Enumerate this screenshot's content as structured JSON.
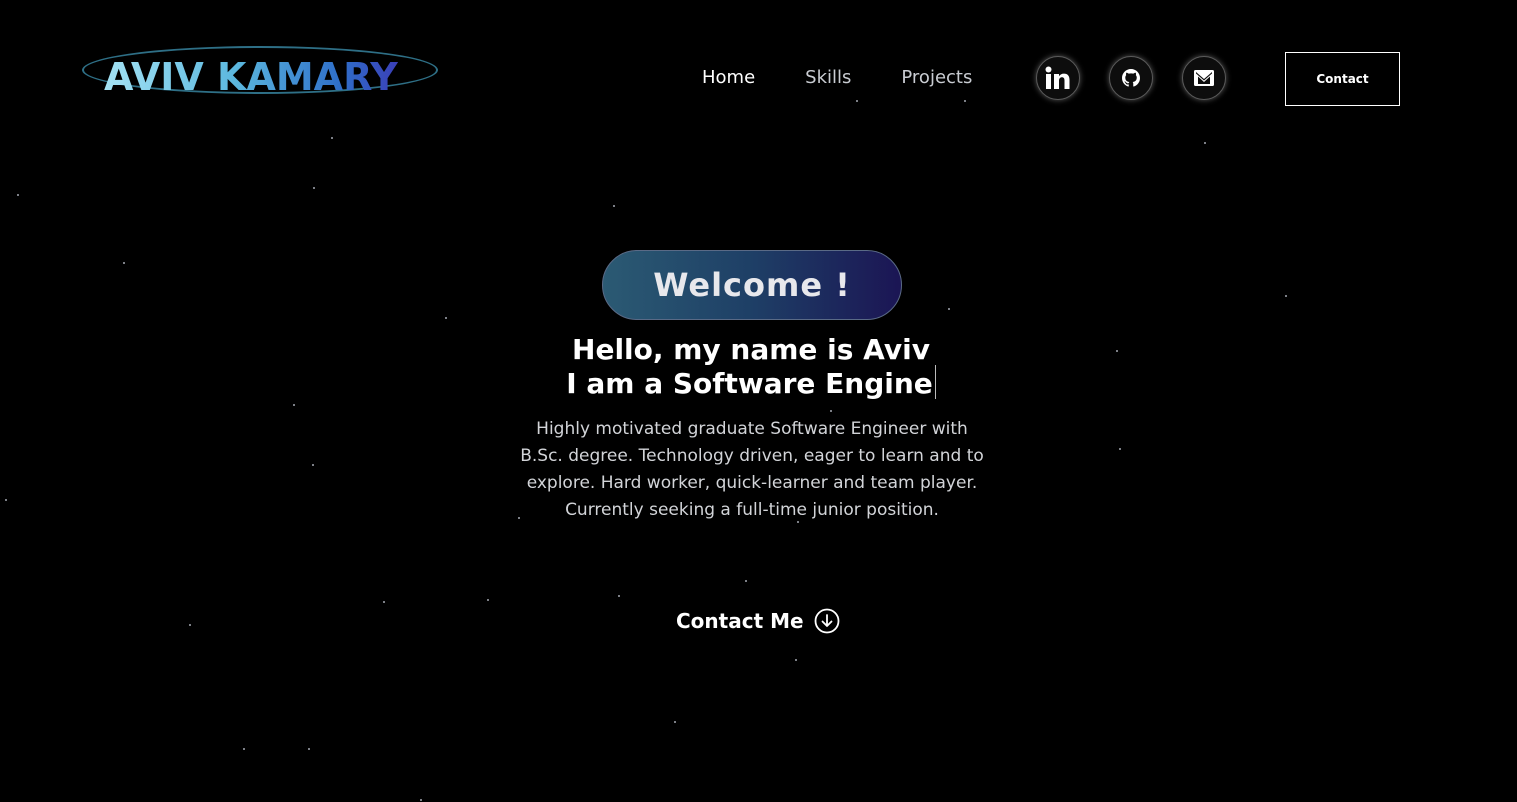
{
  "logo": {
    "text": "AVIV KAMARY"
  },
  "nav": {
    "links": [
      {
        "label": "Home"
      },
      {
        "label": "Skills"
      },
      {
        "label": "Projects"
      }
    ],
    "social": [
      {
        "icon": "linkedin-icon"
      },
      {
        "icon": "github-icon"
      },
      {
        "icon": "mail-icon"
      }
    ],
    "contact_label": "Contact"
  },
  "hero": {
    "badge": "Welcome !",
    "title_line1": "Hello, my name is Aviv",
    "title_line2": "I am a Software Engine",
    "description": "Highly motivated graduate Software Engineer with B.Sc. degree. Technology driven, eager to learn and to explore. Hard worker, quick-learner and team player.",
    "description2": "Currently seeking a full-time junior position.",
    "cta_label": "Contact Me"
  },
  "colors": {
    "background": "#000000",
    "logo_gradient_start": "#a4e2f4",
    "logo_gradient_end": "#3a3fb8",
    "badge_gradient_start": "#2b5a73",
    "badge_gradient_end": "#1b1554"
  }
}
